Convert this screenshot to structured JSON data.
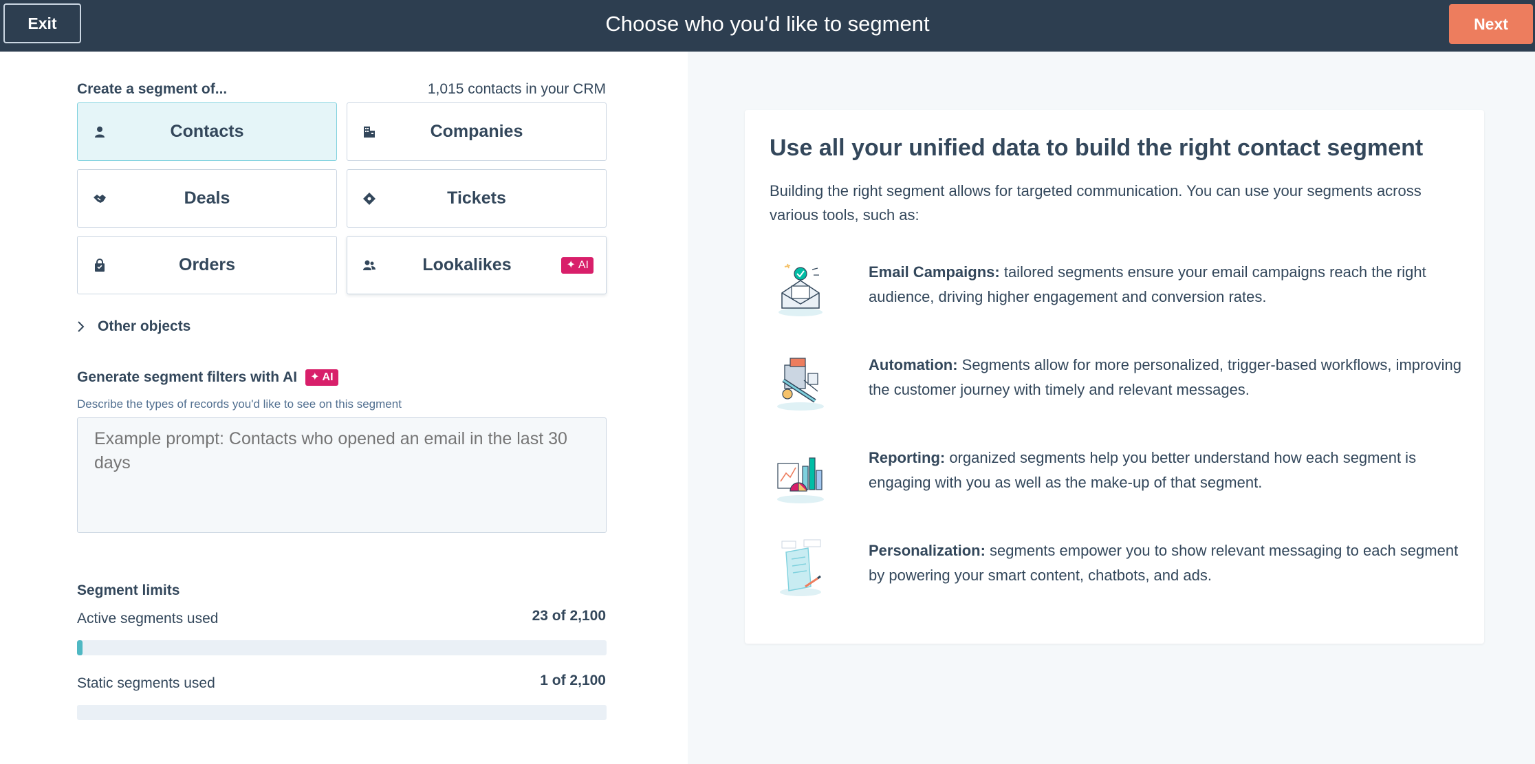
{
  "header": {
    "exit_label": "Exit",
    "title": "Choose who you'd like to segment",
    "next_label": "Next"
  },
  "left": {
    "create_label": "Create a segment of...",
    "crm_count": "1,015 contacts in your CRM",
    "objects": [
      {
        "label": "Contacts",
        "icon": "contact-icon",
        "selected": true
      },
      {
        "label": "Companies",
        "icon": "building-icon",
        "selected": false
      },
      {
        "label": "Deals",
        "icon": "handshake-icon",
        "selected": false
      },
      {
        "label": "Tickets",
        "icon": "ticket-icon",
        "selected": false
      },
      {
        "label": "Orders",
        "icon": "bag-icon",
        "selected": false
      },
      {
        "label": "Lookalikes",
        "icon": "lookalike-icon",
        "selected": false,
        "badge": "AI"
      }
    ],
    "other_objects_label": "Other objects",
    "ai": {
      "title": "Generate segment filters with AI",
      "badge": "AI",
      "description": "Describe the types of records you'd like to see on this segment",
      "placeholder": "Example prompt: Contacts who opened an email in the last 30 days"
    },
    "limits": {
      "title": "Segment limits",
      "active_label": "Active segments used",
      "active_value": "23 of 2,100",
      "active_fraction": 0.011,
      "static_label": "Static segments used",
      "static_value": "1 of 2,100",
      "static_fraction": 0.0005
    }
  },
  "card": {
    "title": "Use all your unified data to build the right contact segment",
    "intro": "Building the right segment allows for targeted communication. You can use your segments across various tools, such as:",
    "benefits": [
      {
        "title": "Email Campaigns:",
        "text": " tailored segments ensure your email campaigns reach the right audience, driving higher engagement and conversion rates.",
        "icon": "email-illustration-icon"
      },
      {
        "title": "Automation:",
        "text": " Segments allow for more personalized, trigger-based workflows, improving the customer journey with timely and relevant messages.",
        "icon": "automation-illustration-icon"
      },
      {
        "title": "Reporting:",
        "text": " organized segments help you better understand how each segment is engaging with you as well as the make-up of that segment.",
        "icon": "reporting-illustration-icon"
      },
      {
        "title": "Personalization:",
        "text": " segments empower you to show relevant messaging to each segment by powering your smart content, chatbots, and ads.",
        "icon": "personalization-illustration-icon"
      }
    ]
  },
  "colors": {
    "header_bg": "#2d3e50",
    "next_bg": "#ed7d5e",
    "ai_badge": "#d81f6a",
    "selected_bg": "#e5f5f8",
    "progress_fill": "#4fb8c3"
  }
}
